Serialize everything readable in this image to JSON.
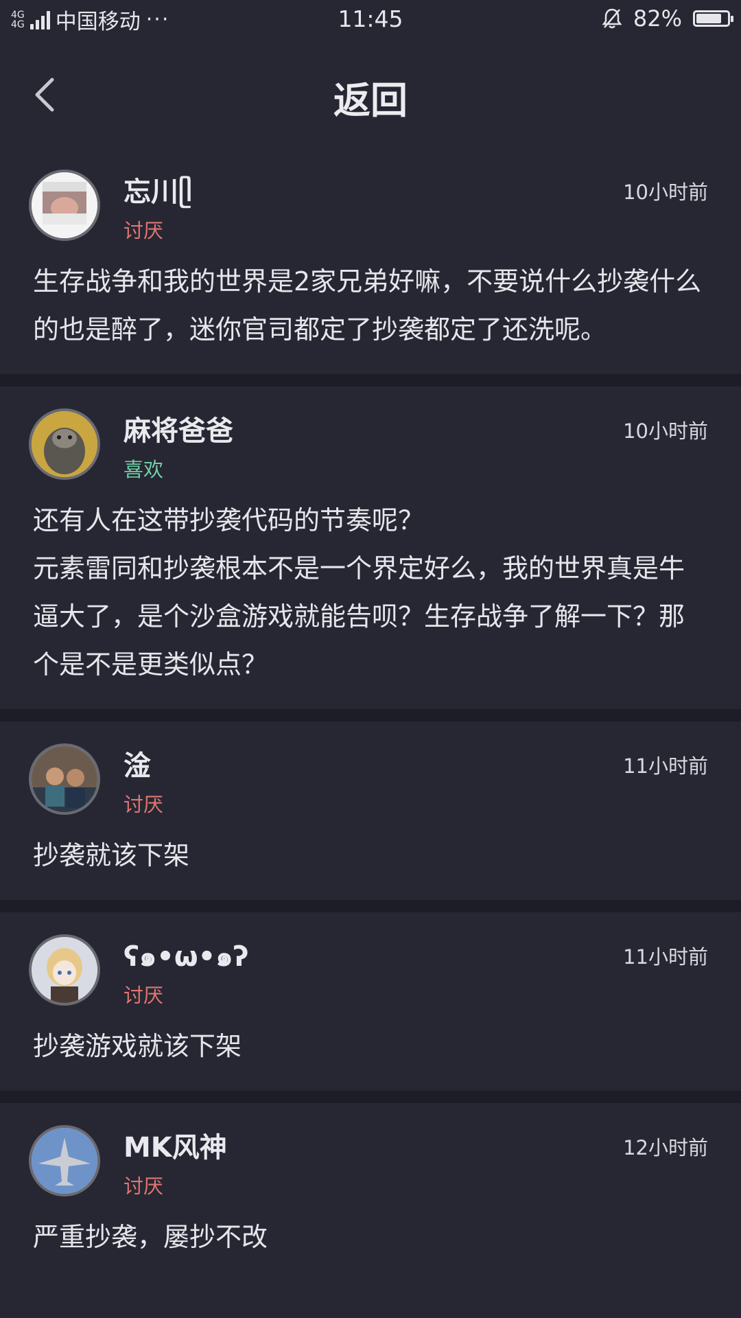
{
  "status": {
    "network_a": "4G",
    "network_b": "4G",
    "carrier": "中国移动",
    "more": "···",
    "time": "11:45",
    "battery": "82%",
    "battery_level": 0.82
  },
  "nav": {
    "title": "返回"
  },
  "comments": [
    {
      "user": "忘川ᥫ",
      "tag": "讨厌",
      "time": "10小时前",
      "body": "生存战争和我的世界是2家兄弟好嘛，不要说什么抄袭什么的也是醉了，迷你官司都定了抄袭都定了还洗呢。"
    },
    {
      "user": "麻将爸爸",
      "tag": "喜欢",
      "time": "10小时前",
      "body": "还有人在这带抄袭代码的节奏呢？\n元素雷同和抄袭根本不是一个界定好么，我的世界真是牛逼大了，是个沙盒游戏就能告呗？生存战争了解一下？那个是不是更类似点？"
    },
    {
      "user": "淦",
      "tag": "讨厌",
      "time": "11小时前",
      "body": "抄袭就该下架"
    },
    {
      "user": "ʕ๑•ω•๑ʔ",
      "tag": "讨厌",
      "time": "11小时前",
      "body": "抄袭游戏就该下架"
    },
    {
      "user": "MK风神",
      "tag": "讨厌",
      "time": "12小时前",
      "body": "严重抄袭，屡抄不改"
    }
  ]
}
